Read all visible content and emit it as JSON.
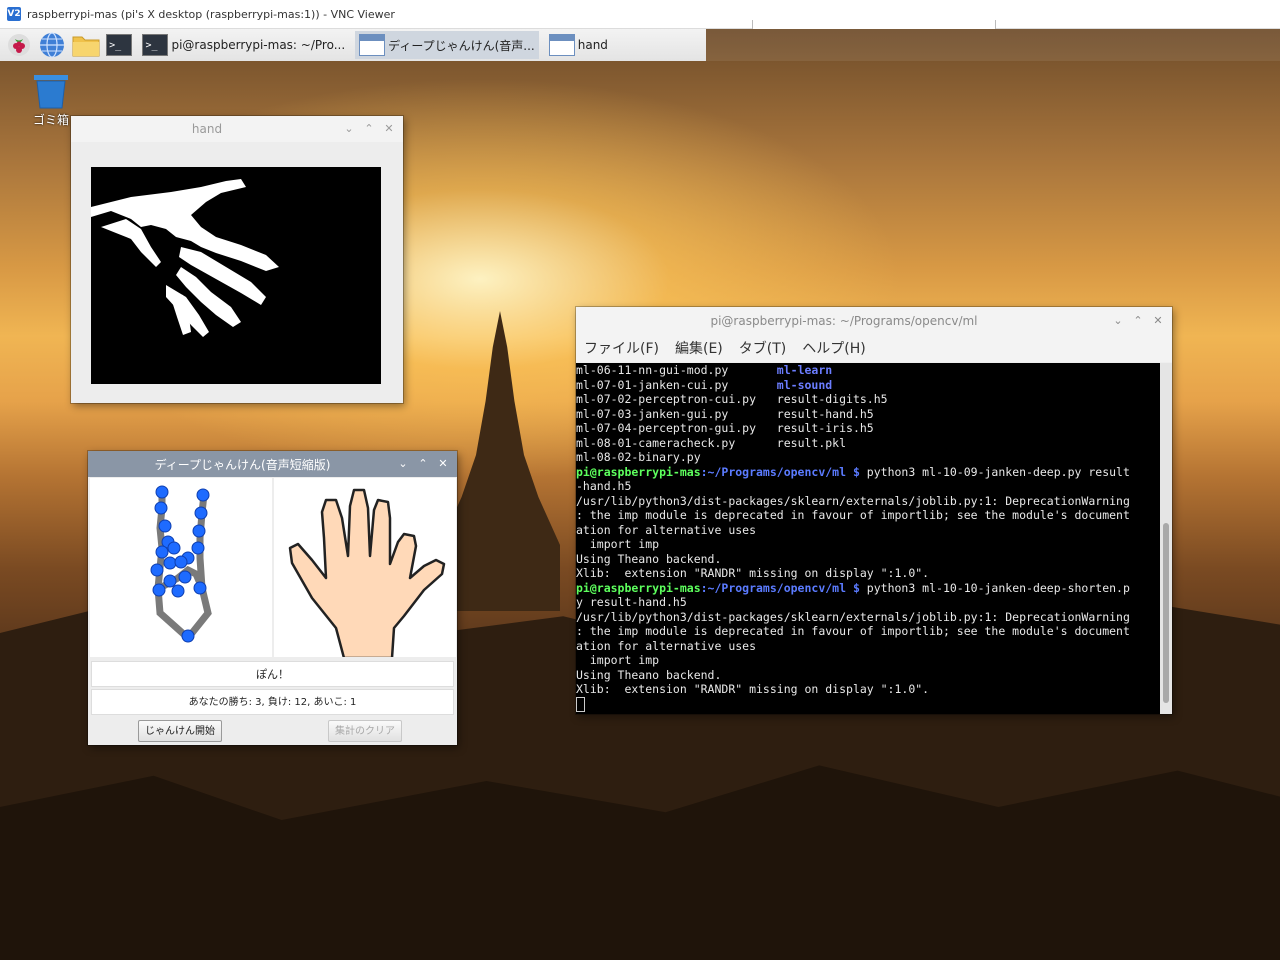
{
  "vnc": {
    "title": "raspberrypi-mas (pi's X desktop (raspberrypi-mas:1)) - VNC Viewer",
    "logo": "V2"
  },
  "taskbar": {
    "launchers": [
      "raspberry-menu-icon",
      "web-browser-icon",
      "file-manager-icon",
      "terminal-icon"
    ],
    "tasks": [
      {
        "label": "pi@raspberrypi-mas: ~/Pro...",
        "icon": "terminal-icon",
        "active": false
      },
      {
        "label": "ディープじゃんけん(音声...",
        "icon": "window-icon",
        "active": true
      },
      {
        "label": "hand",
        "icon": "window-icon",
        "active": false
      }
    ]
  },
  "desktop": {
    "trash_label": "ゴミ箱"
  },
  "hand_window": {
    "title": "hand"
  },
  "janken_window": {
    "title": "ディープじゃんけん(音声短縮版)",
    "result_label": "ぽん！",
    "score_label": "あなたの勝ち: 3, 負け: 12, あいこ: 1",
    "start_button": "じゃんけん開始",
    "clear_button": "集計のクリア"
  },
  "terminal_window": {
    "title": "pi@raspberrypi-mas: ~/Programs/opencv/ml",
    "menu": [
      "ファイル(F)",
      "編集(E)",
      "タブ(T)",
      "ヘルプ(H)"
    ],
    "listing": [
      {
        "left": "ml-06-11-nn-gui-mod.py",
        "right": "ml-learn",
        "right_dir": true
      },
      {
        "left": "ml-07-01-janken-cui.py",
        "right": "ml-sound",
        "right_dir": true
      },
      {
        "left": "ml-07-02-perceptron-cui.py",
        "right": "result-digits.h5",
        "right_dir": false
      },
      {
        "left": "ml-07-03-janken-gui.py",
        "right": "result-hand.h5",
        "right_dir": false
      },
      {
        "left": "ml-07-04-perceptron-gui.py",
        "right": "result-iris.h5",
        "right_dir": false
      },
      {
        "left": "ml-08-01-cameracheck.py",
        "right": "result.pkl",
        "right_dir": false
      },
      {
        "left": "ml-08-02-binary.py",
        "right": "",
        "right_dir": false
      }
    ],
    "prompt_user": "pi@raspberrypi-mas",
    "prompt_path": ":~/Programs/opencv/ml $",
    "cmd1_a": " python3 ml-10-09-janken-deep.py result",
    "cmd1_b": "-hand.h5",
    "out1": [
      "/usr/lib/python3/dist-packages/sklearn/externals/joblib.py:1: DeprecationWarning",
      ": the imp module is deprecated in favour of importlib; see the module's document",
      "ation for alternative uses",
      "  import imp",
      "Using Theano backend.",
      "Xlib:  extension \"RANDR\" missing on display \":1.0\"."
    ],
    "cmd2_a": " python3 ml-10-10-janken-deep-shorten.p",
    "cmd2_b": "y result-hand.h5",
    "out2": [
      "/usr/lib/python3/dist-packages/sklearn/externals/joblib.py:1: DeprecationWarning",
      ": the imp module is deprecated in favour of importlib; see the module's document",
      "ation for alternative uses",
      "  import imp",
      "Using Theano backend.",
      "Xlib:  extension \"RANDR\" missing on display \":1.0\"."
    ]
  }
}
